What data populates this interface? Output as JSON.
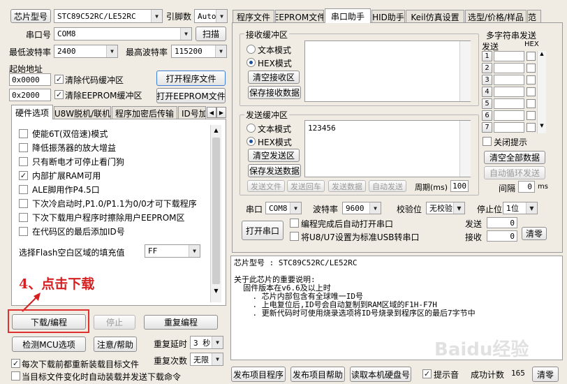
{
  "left": {
    "chip_type_label": "芯片型号",
    "chip_type_value": "STC89C52RC/LE52RC",
    "pin_count_label": "引脚数",
    "pin_count_value": "Auto",
    "port_label": "串口号",
    "port_value": "COM8",
    "scan_button": "扫描",
    "min_baud_label": "最低波特率",
    "min_baud_value": "2400",
    "max_baud_label": "最高波特率",
    "max_baud_value": "115200",
    "start_addr_label": "起始地址",
    "addr1_value": "0x0000",
    "clear_code_label": "清除代码缓冲区",
    "open_prog_button": "打开程序文件",
    "addr2_value": "0x2000",
    "clear_eeprom_label": "清除EEPROM缓冲区",
    "open_eeprom_button": "打开EEPROM文件",
    "tabs": [
      "硬件选项",
      "U8W脱机/联机",
      "程序加密后传输",
      "ID号加"
    ],
    "options": [
      {
        "label": "使能6T(双倍速)模式",
        "checked": false
      },
      {
        "label": "降低振荡器的放大增益",
        "checked": false
      },
      {
        "label": "只有断电才可停止看门狗",
        "checked": false
      },
      {
        "label": "内部扩展RAM可用",
        "checked": true
      },
      {
        "label": "ALE脚用作P4.5口",
        "checked": false
      },
      {
        "label": "下次冷启动时,P1.0/P1.1为0/0才可下载程序",
        "checked": false
      },
      {
        "label": "下次下载用户程序时擦除用户EEPROM区",
        "checked": false
      },
      {
        "label": "在代码区的最后添加ID号",
        "checked": false
      }
    ],
    "fill_label": "选择Flash空白区域的填充值",
    "fill_value": "FF",
    "annotation": "4、点击下载",
    "download_button": "下载/编程",
    "stop_button": "停止",
    "reprogram_button": "重复编程",
    "detect_button": "检测MCU选项",
    "help_button": "注意/帮助",
    "repeat_delay_label": "重复延时",
    "repeat_delay_value": "3 秒",
    "repeat_count_label": "重复次数",
    "repeat_count_value": "无限",
    "reload_label": "每次下载前都重新装载目标文件",
    "autosend_label": "当目标文件变化时自动装载并发送下载命令"
  },
  "right": {
    "tabs": [
      "程序文件",
      "EEPROM文件",
      "串口助手",
      "HID助手",
      "Keil仿真设置",
      "选型/价格/样品",
      "范"
    ],
    "receive_group": "接收缓冲区",
    "text_mode": "文本模式",
    "hex_mode": "HEX模式",
    "clear_receive": "清空接收区",
    "save_receive": "保存接收数据",
    "send_group": "发送缓冲区",
    "send_content": "123456",
    "clear_send": "清空发送区",
    "save_send": "保存发送数据",
    "send_file": "发送文件",
    "send_enter": "发送回车",
    "send_data": "发送数据",
    "auto_send": "自动发送",
    "period_label": "周期(ms)",
    "period_value": "100",
    "multi_title": "多字符串发送",
    "multi_send_header": "发送",
    "multi_hex_header": "HEX",
    "multi_rows": [
      "1",
      "2",
      "3",
      "4",
      "5",
      "6",
      "7"
    ],
    "close_hint": "关闭提示",
    "clear_all": "清空全部数据",
    "auto_loop": "自动循环发送",
    "interval_label": "间隔",
    "interval_value": "0",
    "interval_unit": "ms",
    "port_label": "串口",
    "port_value": "COM8",
    "baud_label": "波特率",
    "baud_value": "9600",
    "parity_label": "校验位",
    "parity_value": "无校验",
    "stopbits_label": "停止位",
    "stopbits_value": "1位",
    "open_port": "打开串口",
    "auto_open_label": "编程完成后自动打开串口",
    "usb_label": "将U8/U7设置为标准USB转串口",
    "sent_label": "发送",
    "sent_value": "0",
    "recv_label": "接收",
    "recv_value": "0",
    "clear_counter": "清零"
  },
  "info": {
    "chip_line": "芯片型号 : STC89C52RC/LE52RC",
    "notes": [
      "关于此芯片的重要说明:",
      "  固件版本在v6.6及以上时",
      "    . 芯片内部包含有全球唯一ID号",
      "    . 上电复位后,ID号会自动复制到RAM区域的F1H-F7H",
      "    . 更新代码时可使用烧录选项将ID号烧录到程序区的最后7字节中"
    ]
  },
  "bottom": {
    "publish_program": "发布项目程序",
    "publish_help": "发布项目帮助",
    "read_disk": "读取本机硬盘号",
    "beep_label": "提示音",
    "success_label": "成功计数",
    "success_value": "165",
    "clear_button": "清零"
  },
  "watermark": "Baidu经验",
  "colors": {
    "annotation": "#d42020",
    "highlight_box": "#e03030",
    "window_bg": "#f0ece4"
  }
}
